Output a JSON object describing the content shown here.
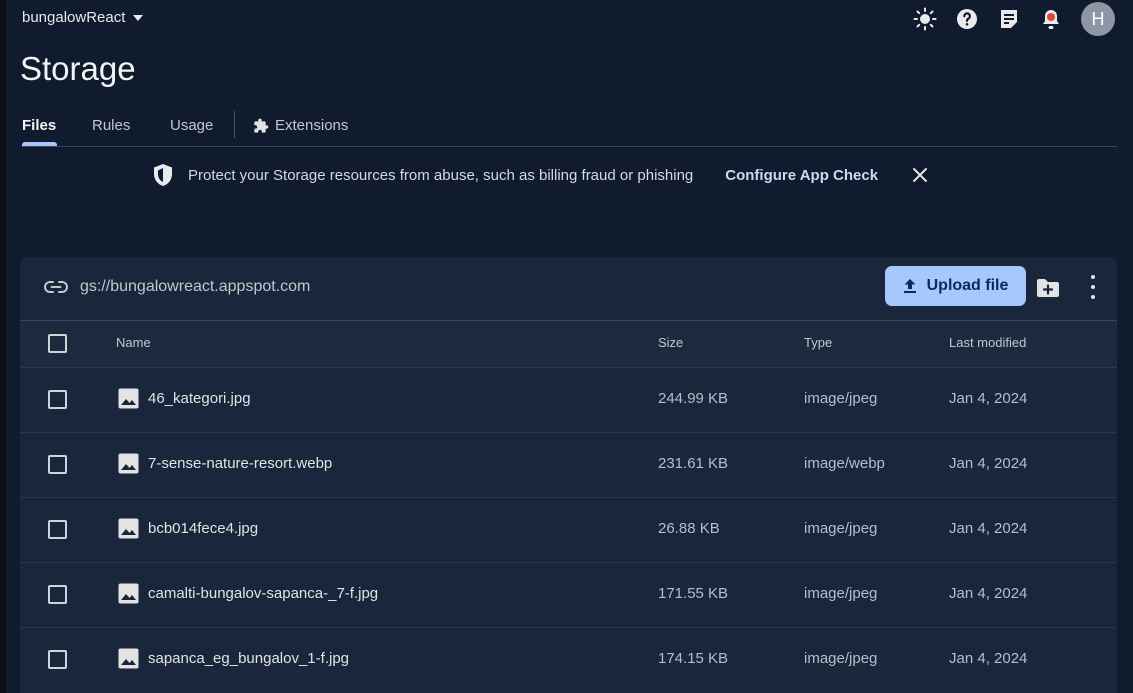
{
  "project": {
    "name": "bungalowReact"
  },
  "header": {
    "title": "Storage",
    "avatar_letter": "H"
  },
  "tabs": [
    {
      "label": "Files"
    },
    {
      "label": "Rules"
    },
    {
      "label": "Usage"
    },
    {
      "label": "Extensions"
    }
  ],
  "banner": {
    "text": "Protect your Storage resources from abuse, such as billing fraud or phishing",
    "link": "Configure App Check"
  },
  "bucket": {
    "path": "gs://bungalowreact.appspot.com"
  },
  "toolbar": {
    "upload_label": "Upload file"
  },
  "table": {
    "columns": {
      "name": "Name",
      "size": "Size",
      "type": "Type",
      "modified": "Last modified"
    },
    "rows": [
      {
        "name": "46_kategori.jpg",
        "size": "244.99 KB",
        "type": "image/jpeg",
        "modified": "Jan 4, 2024"
      },
      {
        "name": "7-sense-nature-resort.webp",
        "size": "231.61 KB",
        "type": "image/webp",
        "modified": "Jan 4, 2024"
      },
      {
        "name": "bcb014fece4.jpg",
        "size": "26.88 KB",
        "type": "image/jpeg",
        "modified": "Jan 4, 2024"
      },
      {
        "name": "camalti-bungalov-sapanca-_7-f.jpg",
        "size": "171.55 KB",
        "type": "image/jpeg",
        "modified": "Jan 4, 2024"
      },
      {
        "name": "sapanca_eg_bungalov_1-f.jpg",
        "size": "174.15 KB",
        "type": "image/jpeg",
        "modified": "Jan 4, 2024"
      }
    ]
  },
  "colors": {
    "accent": "#a8c7fa",
    "background": "#101b2d",
    "panel": "#19263b"
  },
  "icons": [
    "brightness-icon",
    "help-icon",
    "notes-icon",
    "notification-icon",
    "link-icon",
    "shield-icon",
    "close-icon",
    "upload-icon",
    "new-folder-icon",
    "more-vert-icon",
    "image-file-icon",
    "extensions-icon"
  ]
}
